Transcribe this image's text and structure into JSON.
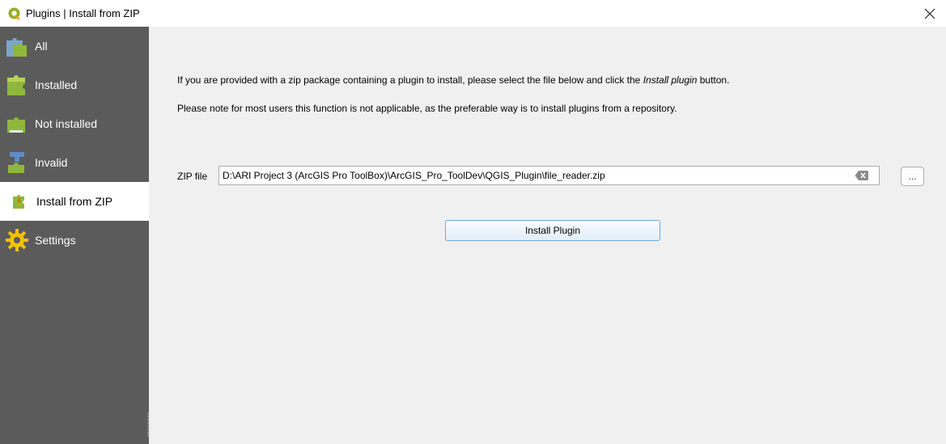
{
  "window": {
    "title": "Plugins | Install from ZIP",
    "app_icon": "qgis-logo-icon",
    "close_icon": "close-icon",
    "colors": {
      "sidebar_bg": "#5b5b5b",
      "content_bg": "#f0f0f0",
      "accent": "#6fa8dc"
    }
  },
  "sidebar": {
    "items": [
      {
        "label": "All",
        "icon": "puzzle-all-icon",
        "selected": false
      },
      {
        "label": "Installed",
        "icon": "puzzle-installed-icon",
        "selected": false
      },
      {
        "label": "Not installed",
        "icon": "puzzle-not-installed-icon",
        "selected": false
      },
      {
        "label": "Invalid",
        "icon": "puzzle-invalid-icon",
        "selected": false
      },
      {
        "label": "Install from ZIP",
        "icon": "puzzle-zip-icon",
        "selected": true
      },
      {
        "label": "Settings",
        "icon": "gear-icon",
        "selected": false
      }
    ]
  },
  "content": {
    "info_line1_before": "If you are provided with a zip package containing a plugin to install, please select the file below and click the ",
    "info_line1_emph": "Install plugin",
    "info_line1_after": " button.",
    "info_line2": "Please note for most users this function is not applicable, as the preferable way is to install plugins from a repository.",
    "zip_label": "ZIP file",
    "zip_value": "D:\\ARI Project 3 (ArcGIS Pro ToolBox)\\ArcGIS_Pro_ToolDev\\QGIS_Plugin\\file_reader.zip",
    "browse_label": "...",
    "install_button": "Install Plugin"
  }
}
